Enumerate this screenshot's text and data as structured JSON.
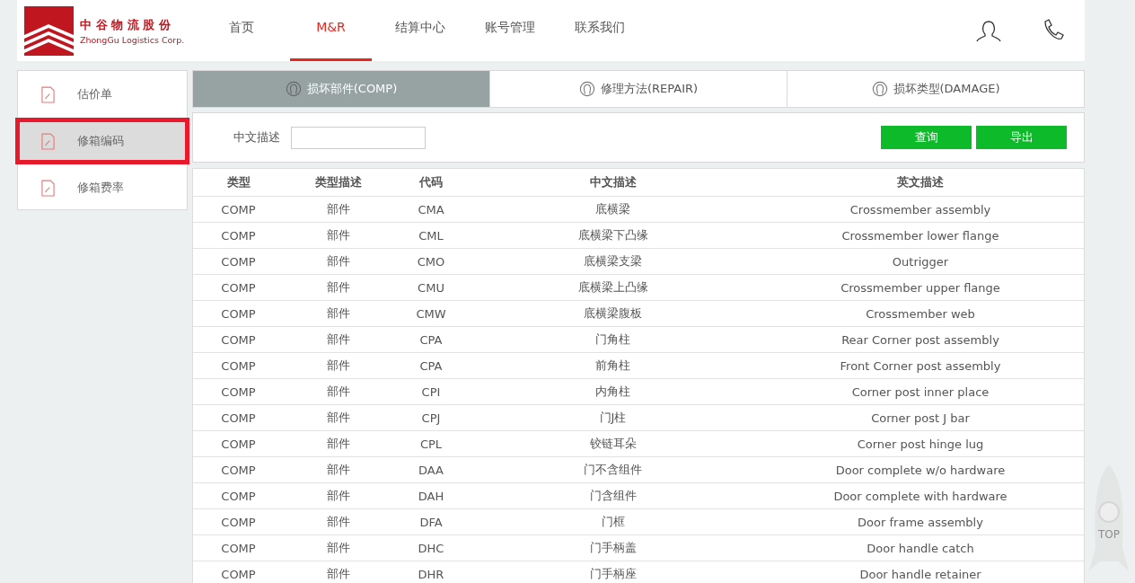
{
  "logo": {
    "name_cn": "中 谷 物 流 股 份",
    "name_en": "ZhongGu Logistics Corp."
  },
  "nav": [
    {
      "label": "首页",
      "selected": false
    },
    {
      "label": "M&R",
      "selected": true
    },
    {
      "label": "结算中心",
      "selected": false
    },
    {
      "label": "账号管理",
      "selected": false
    },
    {
      "label": "联系我们",
      "selected": false
    }
  ],
  "sidebar": {
    "items": [
      {
        "label": "估价单",
        "selected": false
      },
      {
        "label": "修箱编码",
        "selected": true
      },
      {
        "label": "修箱费率",
        "selected": false
      }
    ]
  },
  "tabs": [
    {
      "label": "损坏部件(COMP)",
      "selected": true
    },
    {
      "label": "修理方法(REPAIR)",
      "selected": false
    },
    {
      "label": "损坏类型(DAMAGE)",
      "selected": false
    }
  ],
  "search": {
    "label": "中文描述",
    "buttons": [
      "查询",
      "导出"
    ]
  },
  "table": {
    "columns": [
      "类型",
      "类型描述",
      "代码",
      "中文描述",
      "英文描述"
    ],
    "rows": [
      [
        "COMP",
        "部件",
        "CMA",
        "底横梁",
        "Crossmember assembly"
      ],
      [
        "COMP",
        "部件",
        "CML",
        "底横梁下凸缘",
        "Crossmember lower flange"
      ],
      [
        "COMP",
        "部件",
        "CMO",
        "底横梁支梁",
        "Outrigger"
      ],
      [
        "COMP",
        "部件",
        "CMU",
        "底横梁上凸缘",
        "Crossmember upper flange"
      ],
      [
        "COMP",
        "部件",
        "CMW",
        "底横梁腹板",
        "Crossmember web"
      ],
      [
        "COMP",
        "部件",
        "CPA",
        "门角柱",
        "Rear Corner post assembly"
      ],
      [
        "COMP",
        "部件",
        "CPA",
        "前角柱",
        "Front Corner post assembly"
      ],
      [
        "COMP",
        "部件",
        "CPI",
        "内角柱",
        "Corner post inner place"
      ],
      [
        "COMP",
        "部件",
        "CPJ",
        "门J柱",
        "Corner post J bar"
      ],
      [
        "COMP",
        "部件",
        "CPL",
        "铰链耳朵",
        "Corner post hinge lug"
      ],
      [
        "COMP",
        "部件",
        "DAA",
        "门不含组件",
        "Door complete w/o hardware"
      ],
      [
        "COMP",
        "部件",
        "DAH",
        "门含组件",
        "Door complete with hardware"
      ],
      [
        "COMP",
        "部件",
        "DFA",
        "门框",
        "Door frame assembly"
      ],
      [
        "COMP",
        "部件",
        "DHC",
        "门手柄盖",
        "Door handle catch"
      ],
      [
        "COMP",
        "部件",
        "DHR",
        "门手柄座",
        "Door handle retainer"
      ]
    ]
  },
  "back_to_top": {
    "label": "TOP"
  }
}
